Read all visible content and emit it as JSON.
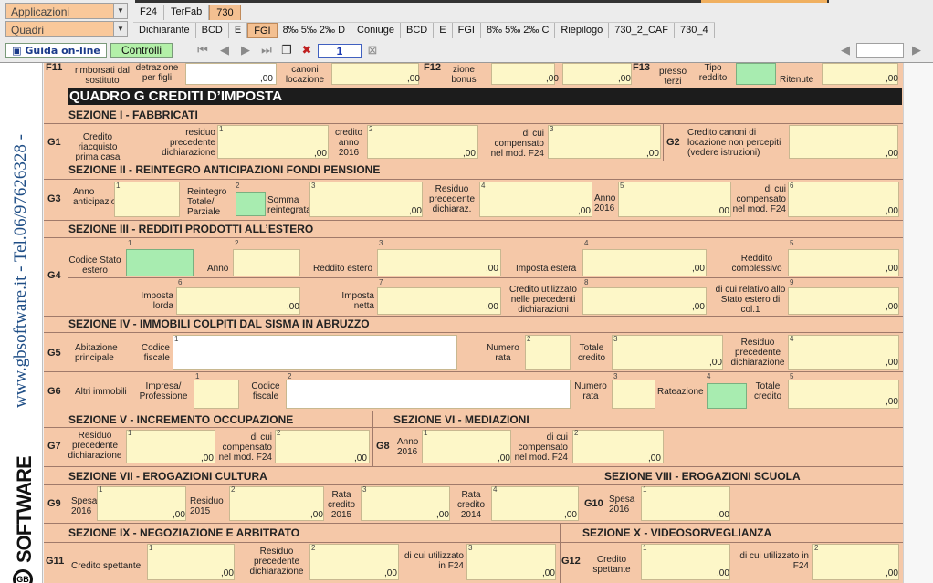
{
  "toolbar": {
    "applicazioni": "Applicazioni",
    "quadri": "Quadri",
    "tabs_row1": [
      "F24",
      "TerFab",
      "730"
    ],
    "tabs_row2": [
      "Dichiarante",
      "BCD",
      "E",
      "FGI",
      "8‰ 5‰ 2‰ D",
      "Coniuge",
      "BCD",
      "E",
      "FGI",
      "8‰ 5‰ 2‰ C",
      "Riepilogo",
      "730_2_CAF",
      "730_4"
    ],
    "guida": "Guida on-line",
    "controlli": "Controlli",
    "page": "1"
  },
  "brand": {
    "text": "www.gbsoftware.it - Tel.06/97626328 -",
    "logo": "SOFTWARE",
    "gb": "GB"
  },
  "form": {
    "top": {
      "f11_code": "F11",
      "f11_a": "rimborsati dal sostituto",
      "f11_b": "detrazione per figli",
      "f11_c": "canoni locazione",
      "f12_code": "F12",
      "f12_a": "zione bonus",
      "f13_code": "F13",
      "f13_a": "presso terzi",
      "f13_b": "Tipo reddito",
      "f13_c": "Ritenute",
      "dec": ",00"
    },
    "quadro_title": "QUADRO   G   CREDITI D’IMPOSTA",
    "s1": {
      "title": "SEZIONE I  -  FABBRICATI",
      "g1": "G1",
      "g1_label": "Credito riacquisto prima casa",
      "residuo": "residuo precedente dichiarazione",
      "credito": "credito anno 2016",
      "compensato": "di cui compensato nel mod. F24",
      "g2": "G2",
      "g2_label": "Credito canoni di locazione non percepiti (vedere istruzioni)"
    },
    "s2": {
      "title": "SEZIONE II  -  REINTEGRO ANTICIPAZIONI FONDI PENSIONE",
      "g3": "G3",
      "anno": "Anno anticipazione",
      "reintegro": "Reintegro Totale/ Parziale",
      "somma": "Somma reintegrata",
      "residuo": "Residuo precedente dichiaraz.",
      "anno2016": "Anno 2016",
      "compensato": "di cui compensato nel mod. F24"
    },
    "s3": {
      "title": "SEZIONE III  -  REDDITI PRODOTTI ALL’ESTERO",
      "g4": "G4",
      "codice": "Codice Stato estero",
      "anno": "Anno",
      "reddito": "Reddito estero",
      "imposta": "Imposta estera",
      "complessivo": "Reddito complessivo",
      "lorda": "Imposta lorda",
      "netta": "Imposta netta",
      "utilizzato": "Credito utilizzato nelle precedenti dichiarazioni",
      "relativo": "di cui relativo allo Stato estero di col.1"
    },
    "s4": {
      "title": "SEZIONE IV  -  IMMOBILI COLPITI DAL SISMA IN ABRUZZO",
      "g5": "G5",
      "abitazione": "Abitazione principale",
      "cf": "Codice fiscale",
      "rata": "Numero rata",
      "totale": "Totale credito",
      "residuo": "Residuo precedente dichiarazione",
      "g6": "G6",
      "altri": "Altri immobili",
      "impresa": "Impresa/ Professione",
      "cf2": "Codice fiscale",
      "rata2": "Numero rata",
      "rateazione": "Rateazione",
      "totale2": "Totale credito"
    },
    "s5": {
      "title": "SEZIONE V  -  INCREMENTO OCCUPAZIONE",
      "g7": "G7",
      "residuo": "Residuo precedente dichiarazione",
      "compensato": "di cui compensato nel mod. F24"
    },
    "s6": {
      "title": "SEZIONE VI  -  MEDIAZIONI",
      "g8": "G8",
      "anno": "Anno 2016",
      "compensato": "di cui compensato nel mod. F24"
    },
    "s7": {
      "title": "SEZIONE VII  -  EROGAZIONI CULTURA",
      "g9": "G9",
      "spesa": "Spesa 2016",
      "residuo": "Residuo 2015",
      "rata2015": "Rata credito 2015",
      "rata2014": "Rata credito 2014"
    },
    "s8": {
      "title": "SEZIONE VIII  -  EROGAZIONI SCUOLA",
      "g10": "G10",
      "spesa": "Spesa 2016"
    },
    "s9": {
      "title": "SEZIONE IX  -  NEGOZIAZIONE E ARBITRATO",
      "g11": "G11",
      "credito": "Credito spettante",
      "residuo": "Residuo precedente dichiarazione",
      "utilizzato": "di cui utilizzato in F24"
    },
    "s10": {
      "title": "SEZIONE X  -  VIDEOSORVEGLIANZA",
      "g12": "G12",
      "credito": "Credito spettante",
      "utilizzato": "di cui utilizzato in F24"
    },
    "dec": ",00"
  }
}
